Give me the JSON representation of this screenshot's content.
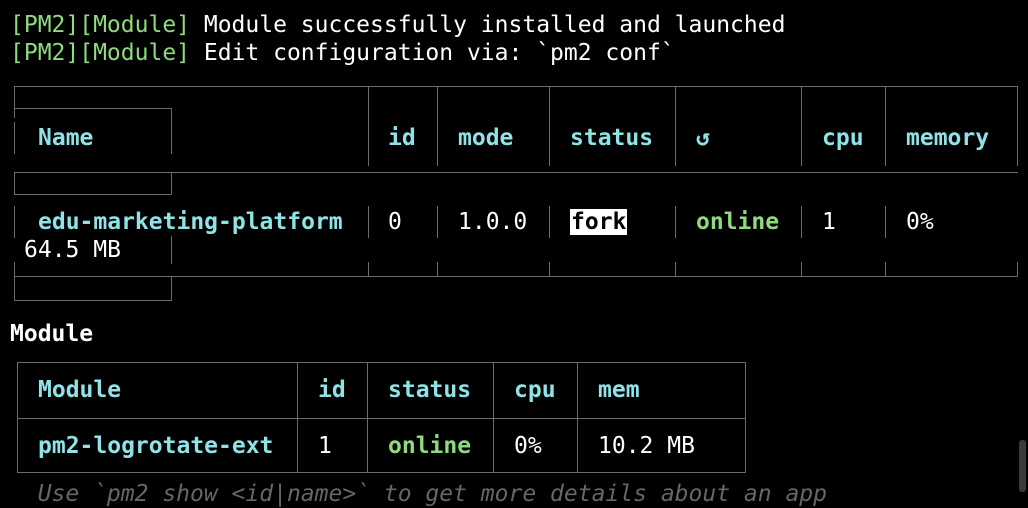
{
  "log": [
    {
      "tag": "[PM2][Module]",
      "message": " Module successfully installed and launched"
    },
    {
      "tag": "[PM2][Module]",
      "message": " Edit configuration via: `pm2 conf`"
    }
  ],
  "process_table": {
    "headers": {
      "name": "Name",
      "id": "id",
      "mode": "mode",
      "status": "status",
      "restart": "↺",
      "cpu": "cpu",
      "memory": "memory"
    },
    "row": {
      "name": "edu-marketing-platform",
      "id": "0",
      "mode": "1.0.0",
      "status": "fork",
      "restart": "online",
      "cpu": "1",
      "memory": "0%",
      "overflow": "64.5 MB"
    }
  },
  "module_section": {
    "title": "Module",
    "headers": {
      "module": "Module",
      "id": "id",
      "status": "status",
      "cpu": "cpu",
      "mem": "mem"
    },
    "row": {
      "module": "pm2-logrotate-ext",
      "id": "1",
      "status": "online",
      "cpu": "0%",
      "mem": "10.2 MB"
    }
  },
  "footer_hint": "  Use `pm2 show <id|name>` to get more details about an app"
}
